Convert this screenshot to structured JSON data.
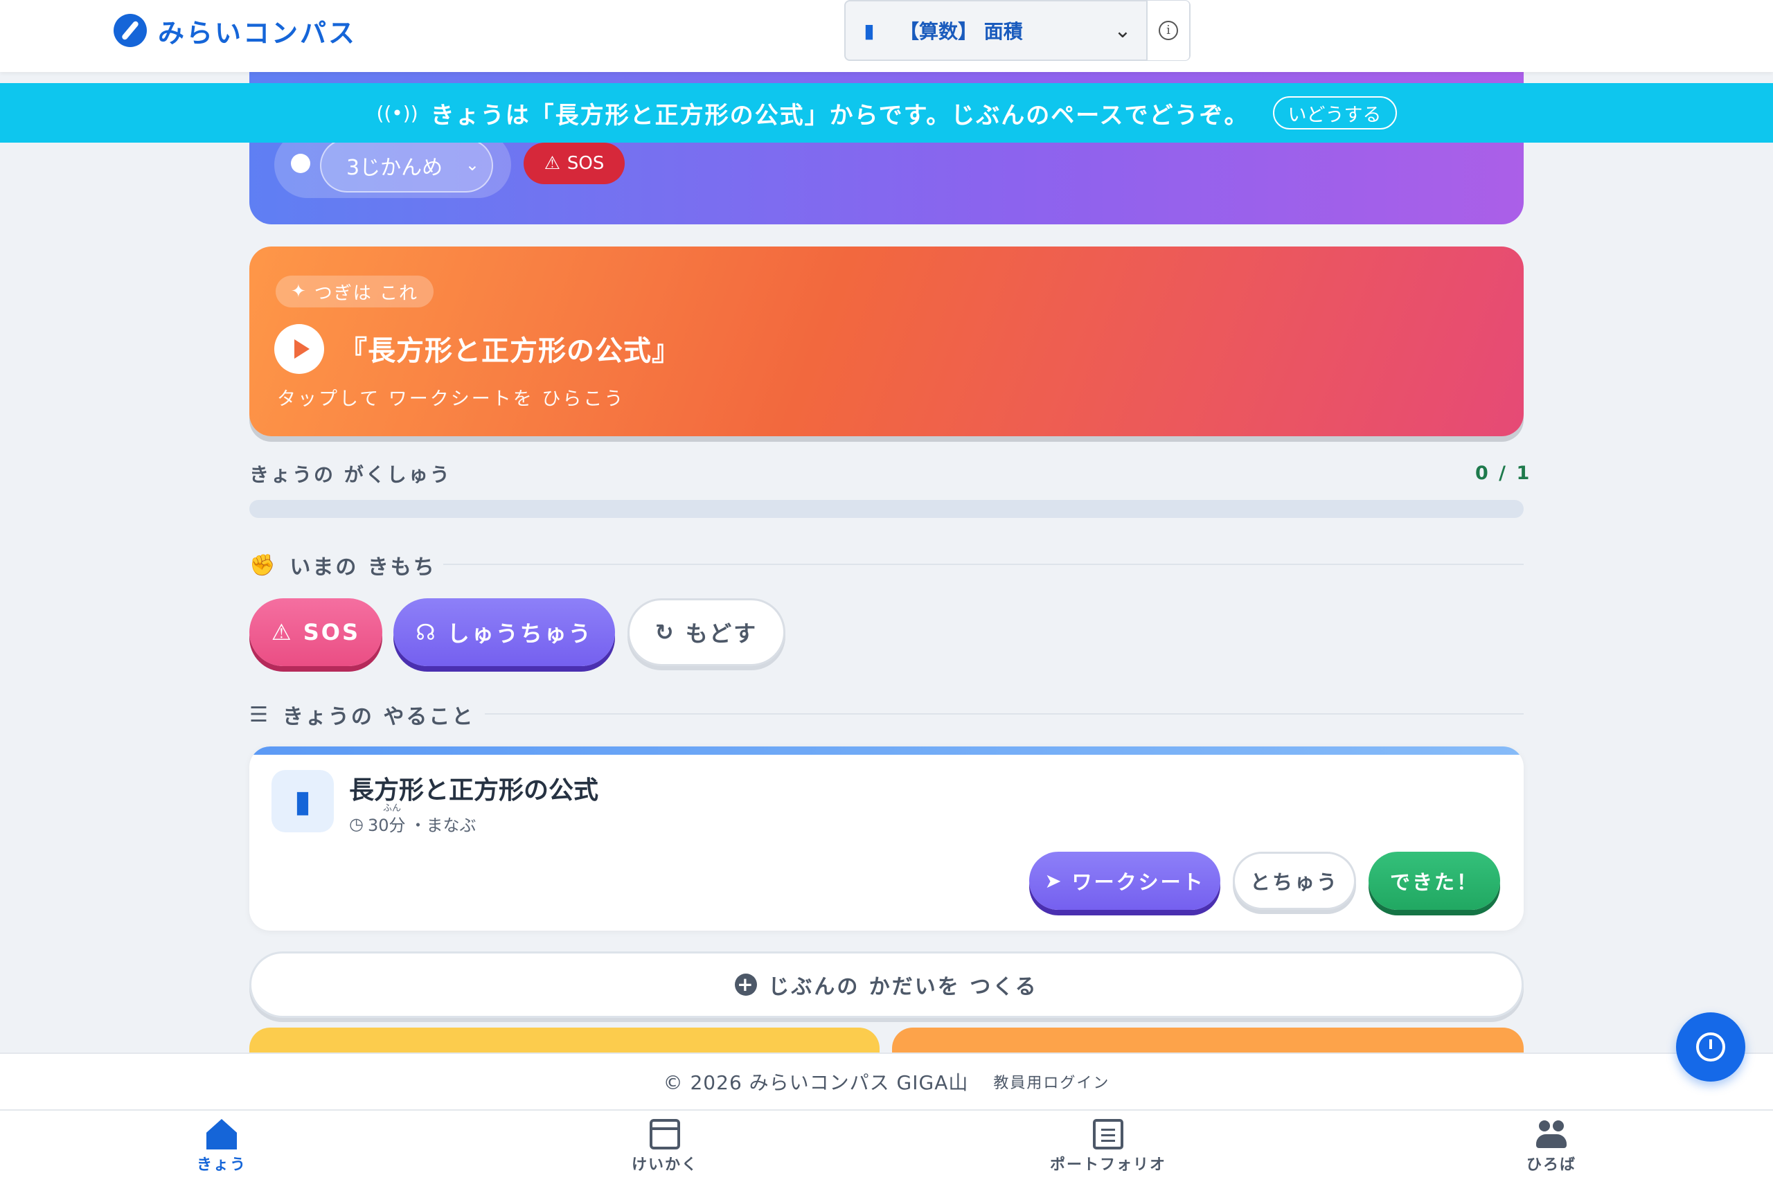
{
  "header": {
    "app_name": "みらいコンパス",
    "subject": "【算数】 面積",
    "info_label": "i"
  },
  "banner": {
    "message": "きょうは「長方形と正方形の公式」からです。じぶんのペースでどうぞ。",
    "button": "いどうする"
  },
  "status": {
    "period": "3じかんめ",
    "sos": "SOS"
  },
  "next_card": {
    "chip": "つぎは これ",
    "title": "『長方形と正方形の公式』",
    "subtitle": "タップして ワークシートを ひらこう"
  },
  "progress": {
    "label": "きょうの がくしゅう",
    "count": "0 / 1",
    "fraction": 0
  },
  "mood": {
    "heading": "いまの きもち",
    "sos": "SOS",
    "focus": "しゅうちゅう",
    "reset": "もどす"
  },
  "todo": {
    "heading": "きょうの やること",
    "task": {
      "title": "長方形と正方形の公式",
      "minutes": "30分",
      "ruby": "ふん",
      "type": "・まなぶ",
      "worksheet": "ワークシート",
      "midway": "とちゅう",
      "done": "できた！"
    },
    "create": "じぶんの かだいを つくる"
  },
  "footer": {
    "copyright": "© 2026 みらいコンパス GIGA山",
    "teacher_login": "教員用ログイン"
  },
  "nav": {
    "items": [
      {
        "label": "きょう",
        "icon": "home-icon",
        "active": true
      },
      {
        "label": "けいかく",
        "icon": "calendar-icon",
        "active": false
      },
      {
        "label": "ポートフォリオ",
        "icon": "notebook-icon",
        "active": false
      },
      {
        "label": "ひろば",
        "icon": "people-icon",
        "active": false
      }
    ]
  },
  "colors": {
    "brand": "#1565d8",
    "banner": "#0ec6ee",
    "sos": "#d6283a",
    "done": "#27ae60"
  }
}
